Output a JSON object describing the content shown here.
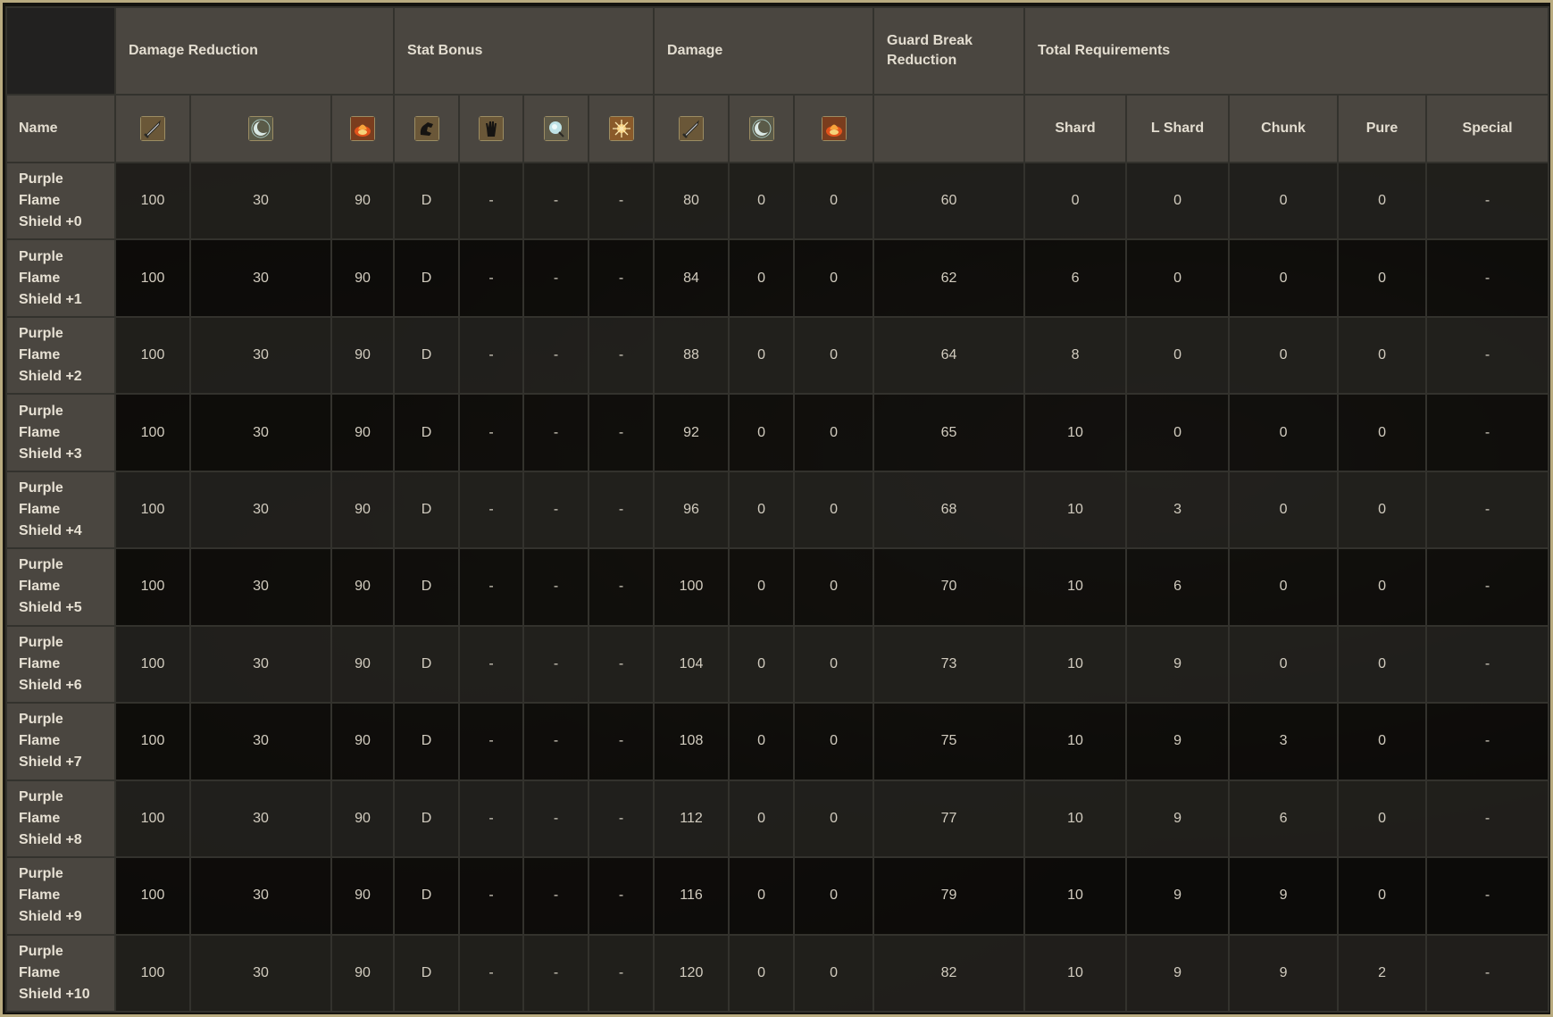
{
  "header": {
    "groups": [
      "Damage Reduction",
      "Stat Bonus",
      "Damage",
      "Guard Break Reduction",
      "Total Requirements"
    ],
    "name_label": "Name",
    "requirement_columns": [
      "Shard",
      "L Shard",
      "Chunk",
      "Pure",
      "Special"
    ]
  },
  "icons": {
    "damage_reduction": [
      "physical-icon",
      "magic-icon",
      "fire-icon"
    ],
    "stat_bonus": [
      "strength-icon",
      "dexterity-icon",
      "intelligence-icon",
      "faith-icon"
    ],
    "damage": [
      "physical-icon",
      "magic-icon",
      "fire-icon"
    ]
  },
  "rows": [
    {
      "name": "Purple Flame Shield +0",
      "dr": [
        "100",
        "30",
        "90"
      ],
      "stat": [
        "D",
        "-",
        "-",
        "-"
      ],
      "dmg": [
        "80",
        "0",
        "0"
      ],
      "guard": "60",
      "req": [
        "0",
        "0",
        "0",
        "0",
        "-"
      ]
    },
    {
      "name": "Purple Flame Shield +1",
      "dr": [
        "100",
        "30",
        "90"
      ],
      "stat": [
        "D",
        "-",
        "-",
        "-"
      ],
      "dmg": [
        "84",
        "0",
        "0"
      ],
      "guard": "62",
      "req": [
        "6",
        "0",
        "0",
        "0",
        "-"
      ]
    },
    {
      "name": "Purple Flame Shield +2",
      "dr": [
        "100",
        "30",
        "90"
      ],
      "stat": [
        "D",
        "-",
        "-",
        "-"
      ],
      "dmg": [
        "88",
        "0",
        "0"
      ],
      "guard": "64",
      "req": [
        "8",
        "0",
        "0",
        "0",
        "-"
      ]
    },
    {
      "name": "Purple Flame Shield +3",
      "dr": [
        "100",
        "30",
        "90"
      ],
      "stat": [
        "D",
        "-",
        "-",
        "-"
      ],
      "dmg": [
        "92",
        "0",
        "0"
      ],
      "guard": "65",
      "req": [
        "10",
        "0",
        "0",
        "0",
        "-"
      ]
    },
    {
      "name": "Purple Flame Shield +4",
      "dr": [
        "100",
        "30",
        "90"
      ],
      "stat": [
        "D",
        "-",
        "-",
        "-"
      ],
      "dmg": [
        "96",
        "0",
        "0"
      ],
      "guard": "68",
      "req": [
        "10",
        "3",
        "0",
        "0",
        "-"
      ]
    },
    {
      "name": "Purple Flame Shield +5",
      "dr": [
        "100",
        "30",
        "90"
      ],
      "stat": [
        "D",
        "-",
        "-",
        "-"
      ],
      "dmg": [
        "100",
        "0",
        "0"
      ],
      "guard": "70",
      "req": [
        "10",
        "6",
        "0",
        "0",
        "-"
      ]
    },
    {
      "name": "Purple Flame Shield +6",
      "dr": [
        "100",
        "30",
        "90"
      ],
      "stat": [
        "D",
        "-",
        "-",
        "-"
      ],
      "dmg": [
        "104",
        "0",
        "0"
      ],
      "guard": "73",
      "req": [
        "10",
        "9",
        "0",
        "0",
        "-"
      ]
    },
    {
      "name": "Purple Flame Shield +7",
      "dr": [
        "100",
        "30",
        "90"
      ],
      "stat": [
        "D",
        "-",
        "-",
        "-"
      ],
      "dmg": [
        "108",
        "0",
        "0"
      ],
      "guard": "75",
      "req": [
        "10",
        "9",
        "3",
        "0",
        "-"
      ]
    },
    {
      "name": "Purple Flame Shield +8",
      "dr": [
        "100",
        "30",
        "90"
      ],
      "stat": [
        "D",
        "-",
        "-",
        "-"
      ],
      "dmg": [
        "112",
        "0",
        "0"
      ],
      "guard": "77",
      "req": [
        "10",
        "9",
        "6",
        "0",
        "-"
      ]
    },
    {
      "name": "Purple Flame Shield +9",
      "dr": [
        "100",
        "30",
        "90"
      ],
      "stat": [
        "D",
        "-",
        "-",
        "-"
      ],
      "dmg": [
        "116",
        "0",
        "0"
      ],
      "guard": "79",
      "req": [
        "10",
        "9",
        "9",
        "0",
        "-"
      ]
    },
    {
      "name": "Purple Flame Shield +10",
      "dr": [
        "100",
        "30",
        "90"
      ],
      "stat": [
        "D",
        "-",
        "-",
        "-"
      ],
      "dmg": [
        "120",
        "0",
        "0"
      ],
      "guard": "82",
      "req": [
        "10",
        "9",
        "9",
        "2",
        "-"
      ]
    }
  ]
}
